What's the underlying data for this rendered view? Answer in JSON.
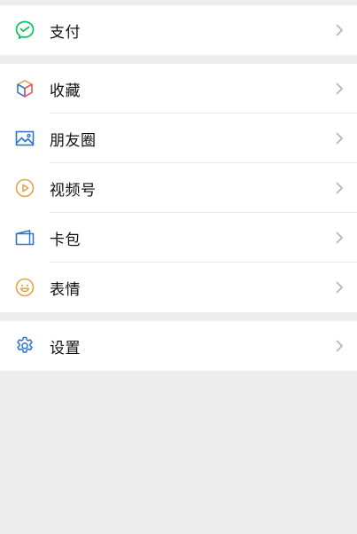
{
  "menu": {
    "pay": {
      "label": "支付",
      "icon": "wechat-pay-icon",
      "color": "#07c160"
    },
    "items": [
      {
        "label": "收藏",
        "icon": "favorites-cube-icon"
      },
      {
        "label": "朋友圈",
        "icon": "moments-image-icon",
        "color": "#2f74c9"
      },
      {
        "label": "视频号",
        "icon": "channels-play-icon",
        "color": "#e2a24a"
      },
      {
        "label": "卡包",
        "icon": "card-wallet-icon",
        "color": "#2f74c9"
      },
      {
        "label": "表情",
        "icon": "sticker-smile-icon",
        "color": "#e2a24a"
      }
    ],
    "settings": {
      "label": "设置",
      "icon": "gear-icon",
      "color": "#2f74c9"
    }
  },
  "colors": {
    "background": "#ededed",
    "card": "#ffffff",
    "chevron": "#b2b2b2"
  }
}
